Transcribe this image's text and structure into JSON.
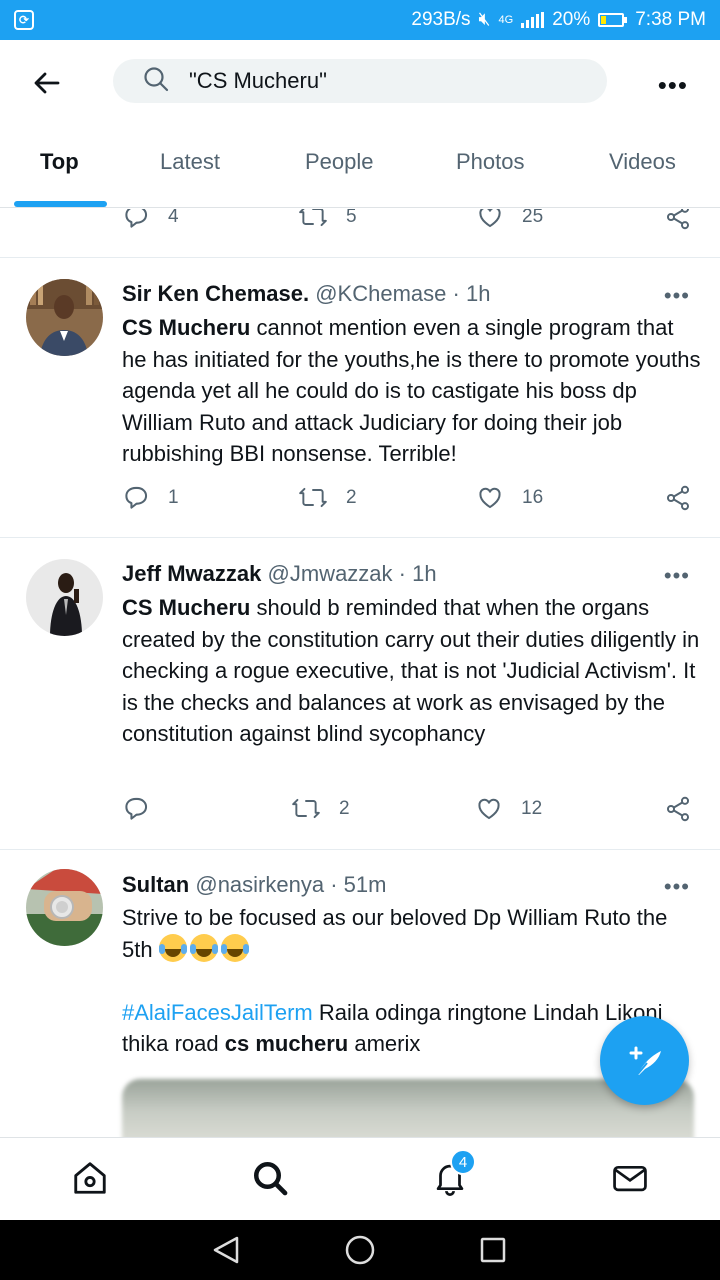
{
  "status_bar": {
    "speed": "293B/s",
    "network": "4G",
    "battery": "20%",
    "time": "7:38 PM"
  },
  "search": {
    "query": "\"CS Mucheru\""
  },
  "tabs": [
    {
      "label": "Top",
      "active": true
    },
    {
      "label": "Latest",
      "active": false
    },
    {
      "label": "People",
      "active": false
    },
    {
      "label": "Photos",
      "active": false
    },
    {
      "label": "Videos",
      "active": false
    }
  ],
  "prev_tweet_actions": {
    "replies": "4",
    "retweets": "5",
    "likes": "25"
  },
  "tweets": [
    {
      "name": "Sir Ken Chemase.",
      "handle": "@KChemase",
      "time": "1h",
      "highlight": "CS Mucheru",
      "text": " cannot mention even a single program that he has initiated for the youths,he is there to promote youths agenda yet all he could do is to castigate his boss dp William Ruto and attack Judiciary for doing their job rubbishing BBI nonsense. Terrible!",
      "replies": "1",
      "retweets": "2",
      "likes": "16"
    },
    {
      "name": "Jeff Mwazzak",
      "handle": "@Jmwazzak",
      "time": "1h",
      "highlight": "CS Mucheru",
      "text": " should b reminded that when the organs created by the constitution carry out their duties diligently in checking a rogue executive, that is not 'Judicial Activism'. It is the checks and balances at work as envisaged by the constitution against blind sycophancy",
      "replies": "",
      "retweets": "2",
      "likes": "12"
    },
    {
      "name": "Sultan",
      "handle": "@nasirkenya",
      "time": "51m",
      "text_line1": "Strive to be focused as our beloved Dp William Ruto the 5th",
      "hashtag": "#AlaiFacesJailTerm",
      "text_after_hashtag": " Raila odinga ringtone Lindah Likoni thika road ",
      "highlight": "cs mucheru",
      "text_end": " amerix"
    }
  ],
  "notifications_badge": "4",
  "colors": {
    "accent": "#1da1f2",
    "text": "#0f1419",
    "muted": "#536471"
  }
}
